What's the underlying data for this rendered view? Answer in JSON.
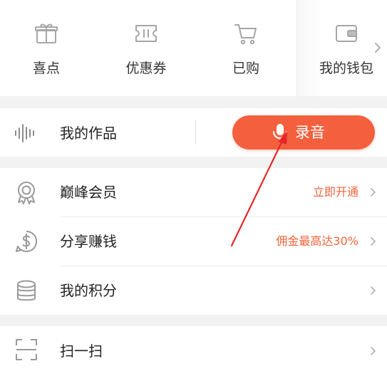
{
  "quick_row": {
    "items": [
      {
        "label": "喜点",
        "icon": "gift-icon"
      },
      {
        "label": "优惠券",
        "icon": "coupon-icon"
      },
      {
        "label": "已购",
        "icon": "cart-icon"
      },
      {
        "label": "我的钱包",
        "icon": "wallet-icon"
      }
    ]
  },
  "works": {
    "label": "我的作品",
    "record_label": "录音",
    "icon": "waveform-icon"
  },
  "menu": {
    "items": [
      {
        "label": "巅峰会员",
        "right": "立即开通",
        "icon": "medal-icon"
      },
      {
        "label": "分享赚钱",
        "right": "佣金最高达30%",
        "icon": "dollar-icon"
      },
      {
        "label": "我的积分",
        "right": "",
        "icon": "coins-stack-icon"
      }
    ]
  },
  "scan": {
    "label": "扫一扫",
    "icon": "scan-icon"
  },
  "colors": {
    "accent": "#f4603e",
    "accent_text": "#f0643c",
    "annotation": "#e8262a",
    "icon_gray": "#9a9a9a"
  }
}
